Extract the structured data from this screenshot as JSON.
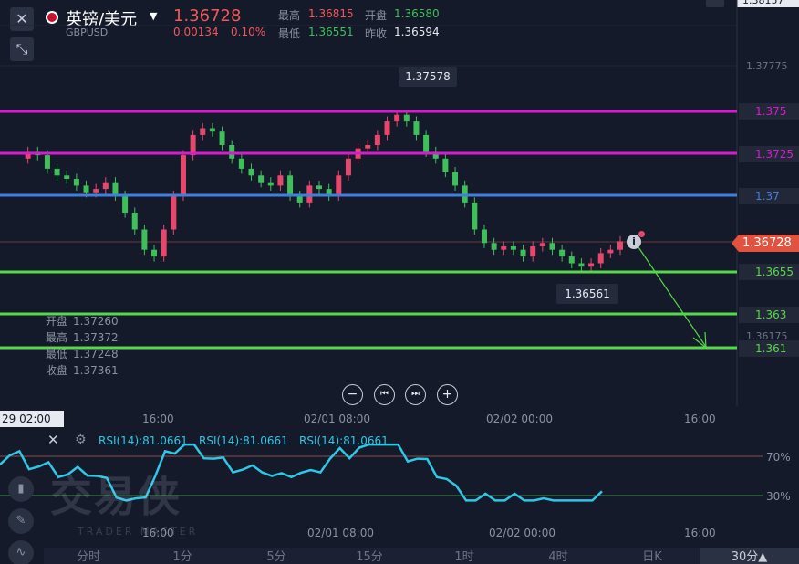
{
  "header": {
    "pair_name": "英镑/美元",
    "pair_code": "GBPUSD",
    "price": "1.36728",
    "change": "0.00134",
    "change_pct": "0.10%",
    "high_label": "最高",
    "high_value": "1.36815",
    "open_label": "开盘",
    "open_value": "1.36580",
    "low_label": "最低",
    "low_value": "1.36551",
    "prev_label": "昨收",
    "prev_value": "1.36594",
    "corner_price": "1.38157"
  },
  "levels": [
    {
      "label": "1.375",
      "color": "#d81bd3"
    },
    {
      "label": "1.3725",
      "color": "#d81bd3"
    },
    {
      "label": "1.37",
      "color": "#3f7fe0"
    },
    {
      "label": "1.3655",
      "color": "#56d84a"
    },
    {
      "label": "1.363",
      "color": "#56d84a"
    },
    {
      "label": "1.361",
      "color": "#56d84a"
    }
  ],
  "axis": {
    "tick_top": "1.37775",
    "tick_bottom": "1.36175",
    "current_price_tag": "1.36728"
  },
  "annotations": {
    "peak_label": "1.37578",
    "trough_label": "1.36561"
  },
  "ohlc_box": {
    "open_label": "开盘",
    "open_value": "1.37260",
    "high_label": "最高",
    "high_value": "1.37372",
    "low_label": "最低",
    "low_value": "1.37248",
    "close_label": "收盘",
    "close_value": "1.37361"
  },
  "controls": {
    "zoom_out": "−",
    "prev": "⏮",
    "next": "⏭",
    "zoom_in": "+"
  },
  "timeline": {
    "cursor_date": "29 02:00 五",
    "labels_main": [
      "16:00",
      "02/01 08:00",
      "02/02 00:00",
      "16:00"
    ],
    "labels_rsi": [
      "16:00",
      "02/01 08:00",
      "02/02 00:00",
      "16:00"
    ]
  },
  "rsi": {
    "label1": "RSI(14):81.0661",
    "label2": "RSI(14):81.0661",
    "label3": "RSI(14):81.0661",
    "level_high": "70%",
    "level_low": "30%",
    "color": "#2ec7e6"
  },
  "watermark": {
    "cn": "交易侠",
    "en": "TRADER MASTER"
  },
  "tabs": [
    "分时",
    "1分",
    "5分",
    "15分",
    "1时",
    "4时",
    "日K",
    "30分▲"
  ],
  "colors": {
    "up": "#e6486c",
    "down": "#3fbf5a",
    "price_tag": "#e2533f",
    "background": "#141a2a"
  }
}
